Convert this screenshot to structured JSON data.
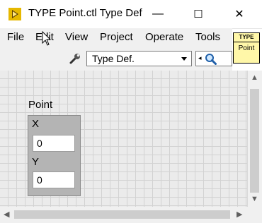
{
  "window": {
    "title": "TYPE Point.ctl Type Def",
    "controls": {
      "minimize": "—",
      "maximize": "☐",
      "close": "✕"
    }
  },
  "menu": {
    "items": [
      "File",
      "Edit",
      "View",
      "Project",
      "Operate",
      "Tools"
    ]
  },
  "toolbar": {
    "dropdown_value": "Type Def.",
    "icons": [
      "wrench-icon",
      "search-icon"
    ]
  },
  "typedef_icon": {
    "top_text": "TYPE",
    "bottom_text": "Point"
  },
  "cluster": {
    "label": "Point",
    "elements": [
      {
        "label": "X",
        "value": "0"
      },
      {
        "label": "Y",
        "value": "0"
      }
    ]
  },
  "colors": {
    "grid_bg": "#ebebeb",
    "cluster_bg": "#b4b4b4",
    "typedef_bg": "#fff7a8",
    "app_icon": "#e6b800"
  }
}
